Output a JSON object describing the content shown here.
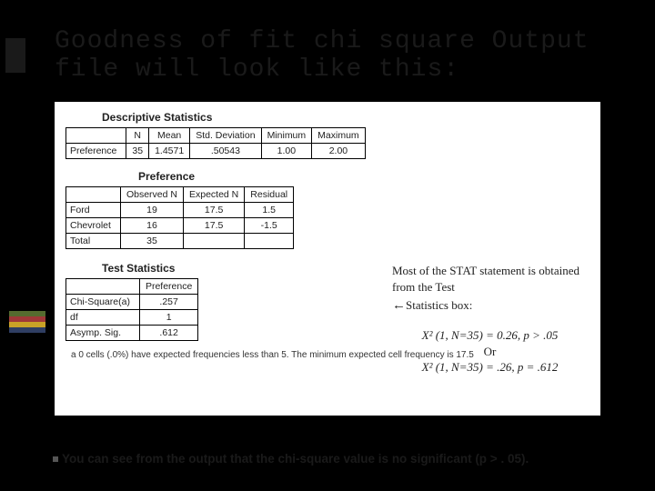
{
  "title": "Goodness of fit chi square Output file will look like this:",
  "desc": {
    "heading": "Descriptive Statistics",
    "cols": [
      "N",
      "Mean",
      "Std. Deviation",
      "Minimum",
      "Maximum"
    ],
    "row_label": "Preference",
    "row": [
      "35",
      "1.4571",
      ".50543",
      "1.00",
      "2.00"
    ]
  },
  "pref": {
    "heading": "Preference",
    "cols": [
      "Observed N",
      "Expected N",
      "Residual"
    ],
    "rows": [
      {
        "label": "Ford",
        "vals": [
          "19",
          "17.5",
          "1.5"
        ]
      },
      {
        "label": "Chevrolet",
        "vals": [
          "16",
          "17.5",
          "-1.5"
        ]
      },
      {
        "label": "Total",
        "vals": [
          "35",
          "",
          ""
        ]
      }
    ]
  },
  "test": {
    "heading": "Test Statistics",
    "col": "Preference",
    "rows": [
      {
        "label": "Chi-Square(a)",
        "val": ".257"
      },
      {
        "label": "df",
        "val": "1"
      },
      {
        "label": "Asymp. Sig.",
        "val": ".612"
      }
    ]
  },
  "footnote": "a  0 cells (.0%) have expected frequencies less than 5. The minimum expected cell frequency is 17.5",
  "note": {
    "line1": "Most of the STAT statement is obtained from the Test",
    "line2": "Statistics box:",
    "arrow": "←",
    "formula1": "X² (1, N=35) = 0.26, p > .05",
    "or": "Or",
    "formula2": "X² (1, N=35) = .26, p = .612"
  },
  "bullet": "You can see from the output that the chi-square value is no significant (p > . 05).",
  "chart_data": [
    {
      "type": "table",
      "title": "Descriptive Statistics",
      "columns": [
        "",
        "N",
        "Mean",
        "Std. Deviation",
        "Minimum",
        "Maximum"
      ],
      "rows": [
        [
          "Preference",
          35,
          1.4571,
          0.50543,
          1.0,
          2.0
        ]
      ]
    },
    {
      "type": "table",
      "title": "Preference",
      "columns": [
        "",
        "Observed N",
        "Expected N",
        "Residual"
      ],
      "rows": [
        [
          "Ford",
          19,
          17.5,
          1.5
        ],
        [
          "Chevrolet",
          16,
          17.5,
          -1.5
        ],
        [
          "Total",
          35,
          null,
          null
        ]
      ]
    },
    {
      "type": "table",
      "title": "Test Statistics",
      "columns": [
        "",
        "Preference"
      ],
      "rows": [
        [
          "Chi-Square(a)",
          0.257
        ],
        [
          "df",
          1
        ],
        [
          "Asymp. Sig.",
          0.612
        ]
      ]
    }
  ]
}
